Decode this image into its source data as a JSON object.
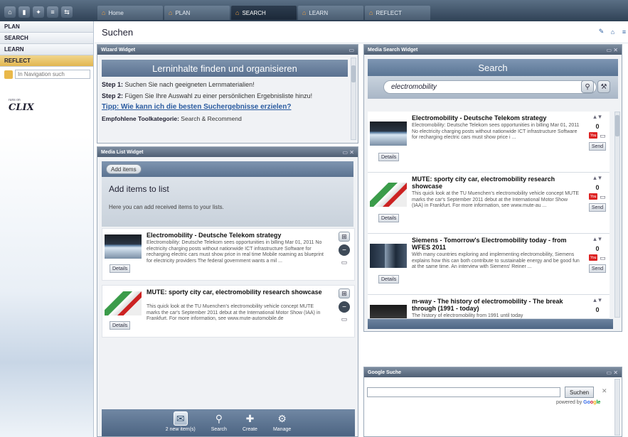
{
  "tabs": [
    {
      "label": "Home"
    },
    {
      "label": "PLAN"
    },
    {
      "label": "SEARCH"
    },
    {
      "label": "LEARN"
    },
    {
      "label": "REFLECT"
    }
  ],
  "sidebar": {
    "items": [
      {
        "label": "PLAN"
      },
      {
        "label": "SEARCH"
      },
      {
        "label": "LEARN"
      },
      {
        "label": "REFLECT"
      }
    ],
    "search_placeholder": "In Navigation such",
    "logo_small": "runs on",
    "logo_big": "CLIX"
  },
  "page": {
    "title": "Suchen"
  },
  "wizard": {
    "header": "Wizard Widget",
    "title": "Lerninhalte finden und organisieren",
    "step1_label": "Step 1:",
    "step1_text": " Suchen Sie nach geeigneten Lernmaterialien!",
    "step2_label": "Step 2:",
    "step2_text": " Fügen Sie Ihre Auswahl zu einer persönlichen Ergebnisliste hinzu!",
    "tip_link": "Tipp: Wie kann ich die besten Suchergebnisse erzielen?",
    "toolcat_label": "Empfohlene Toolkategorie:",
    "toolcat_value": " Search & Recommend"
  },
  "media_list": {
    "header": "Media List Widget",
    "add_button": "Add items",
    "add_title": "Add items to list",
    "add_sub": "Here you can add received items to your lists.",
    "details_label": "Details",
    "items": [
      {
        "title": "Electromobility - Deutsche Telekom strategy",
        "desc": "Electromobility: Deutsche Telekom sees opportunities in billing Mar 01, 2011 No electricity charging posts without nationwide ICT infrastructure Software for recharging electric cars must show price in real time Mobile roaming as blueprint for electricity providers The federal government wants a mil ..."
      },
      {
        "title": "MUTE: sporty city car, electromobility research showcase",
        "desc": "This quick look at the TU Muenchen's electromobility vehicle concept MUTE marks the car's September 2011 debut at the International Motor Show (IAA) in Frankfurt. For more information, see www.mute-automobile.de"
      }
    ],
    "toolbar": [
      {
        "label": "2 new item(s)"
      },
      {
        "label": "Search"
      },
      {
        "label": "Create"
      },
      {
        "label": "Manage"
      }
    ]
  },
  "media_search": {
    "header": "Media Search Widget",
    "title": "Search",
    "query": "electromobility",
    "details_label": "Details",
    "send_label": "Send",
    "results": [
      {
        "title": "Electromobility - Deutsche Telekom strategy",
        "desc": "Electromobility: Deutsche Telekom sees opportunities in billing Mar 01, 2011 No electricity charging posts without nationwide ICT infrastructure Software for recharging electric cars must show price i ...",
        "count": "0"
      },
      {
        "title": "MUTE: sporty city car, electromobility research showcase",
        "desc": "This quick look at the TU Muenchen's electromobility vehicle concept MUTE marks the car's September 2011 debut at the International Motor Show (IAA) in Frankfurt. For more information, see www.mute-au ...",
        "count": "0"
      },
      {
        "title": "Siemens - Tomorrow's Electromobility today - from WFES 2011",
        "desc": "With many countries exploring and implementing electromobility, Siemens explains how this can both contribute to sustainable energy and be good fun at the same time. An interview with Siemens' Reiner ...",
        "count": "0"
      },
      {
        "title": "m-way - The history of electromobility - The break through (1991 - today)",
        "desc": "The history of electromobility from 1991 until today",
        "count": "0"
      }
    ]
  },
  "google": {
    "header": "Google Suche",
    "button": "Suchen",
    "powered": "powered by",
    "brand_parts": [
      "Go",
      "o",
      "g",
      "le"
    ]
  },
  "colors": {
    "topbar": "#2f4155",
    "accent_blue": "#5a7594",
    "reflect": "#e2b650",
    "link": "#2a5ba0"
  }
}
